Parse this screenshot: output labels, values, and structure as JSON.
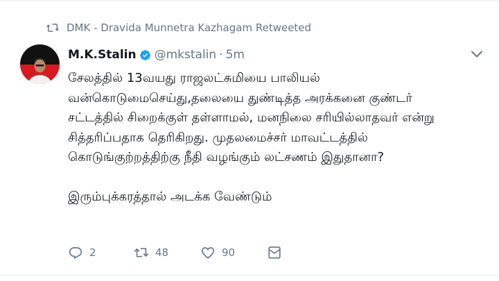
{
  "retweet_context": "DMK - Dravida Munnetra Kazhagam Retweeted",
  "tweet": {
    "display_name": "M.K.Stalin",
    "handle": "@mkstalin",
    "separator": "·",
    "time": "5m",
    "lines": [
      "சேலத்தில் 13வயது ராஜலட்சுமியை பாலியல்",
      "வன்கொடுமைசெய்து,தலையை துண்டித்த அரக்கனை குண்டர்",
      "சட்டத்தில் சிறைக்குள் தள்ளாமல், மனநிலை சரியில்லாதவர் என்று",
      "சித்தரிப்பதாக தெரிகிறது. முதலமைச்சர் மாவட்டத்தில்",
      "கொடுங்குற்றத்திற்கு நீதி வழங்கும் லட்சணம் இதுதானா?"
    ],
    "closing_line": "இரும்புக்கரத்தால் அடக்க வேண்டும்"
  },
  "actions": {
    "reply_count": "2",
    "retweet_count": "48",
    "like_count": "90"
  },
  "icons": {
    "retweet": "retweet-icon",
    "verified": "verified-badge-icon",
    "more": "chevron-down-icon",
    "reply": "reply-icon",
    "like": "heart-icon",
    "dm": "envelope-icon"
  },
  "colors": {
    "secondary_text": "#657786",
    "verified_blue": "#1da1f2"
  }
}
